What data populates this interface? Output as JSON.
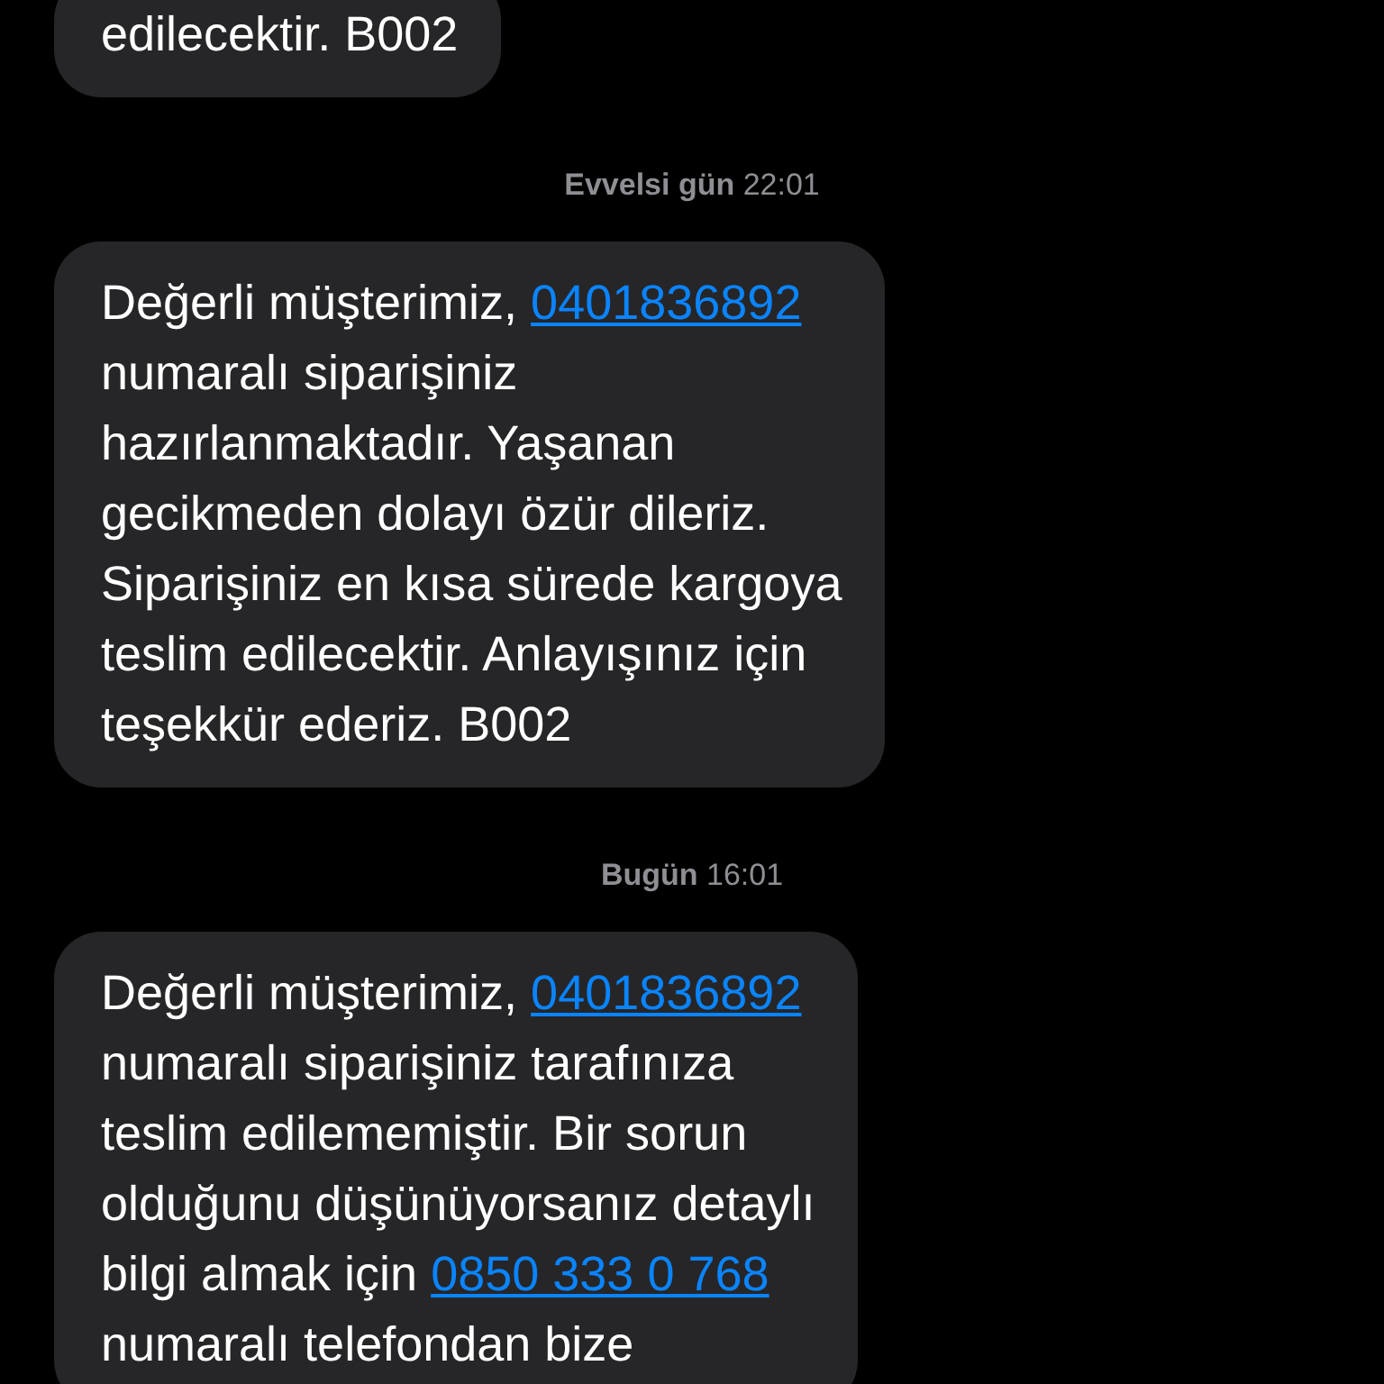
{
  "conversation": [
    {
      "kind": "message",
      "segments": [
        {
          "kind": "text",
          "text": "edilecektir. B002"
        }
      ]
    },
    {
      "kind": "timestamp",
      "text": "**Evvelsi gün** 22:01"
    },
    {
      "kind": "message",
      "segments": [
        {
          "kind": "text",
          "text": "Değerli müşterimiz, "
        },
        {
          "kind": "link",
          "text": "0401836892"
        },
        {
          "kind": "text",
          "text": "\nnumaralı siparişiniz\nhazırlanmaktadır. Yaşanan\ngecikmeden dolayı özür dileriz.\nSiparişiniz en kısa sürede kargoya\nteslim edilecektir. Anlayışınız için\nteşekkür ederiz. B002"
        }
      ]
    },
    {
      "kind": "timestamp",
      "text": "**Bugün** 16:01"
    },
    {
      "kind": "message",
      "segments": [
        {
          "kind": "text",
          "text": "Değerli müşterimiz, "
        },
        {
          "kind": "link",
          "text": "0401836892"
        },
        {
          "kind": "text",
          "text": "\nnumaralı siparişiniz tarafınıza\nteslim edilememiştir. Bir sorun\nolduğunu düşünüyorsanız detaylı\nbilgi almak için "
        },
        {
          "kind": "link",
          "text": "0850 333 0 768"
        },
        {
          "kind": "text",
          "text": "\nnumaralı telefondan bize"
        }
      ]
    }
  ]
}
